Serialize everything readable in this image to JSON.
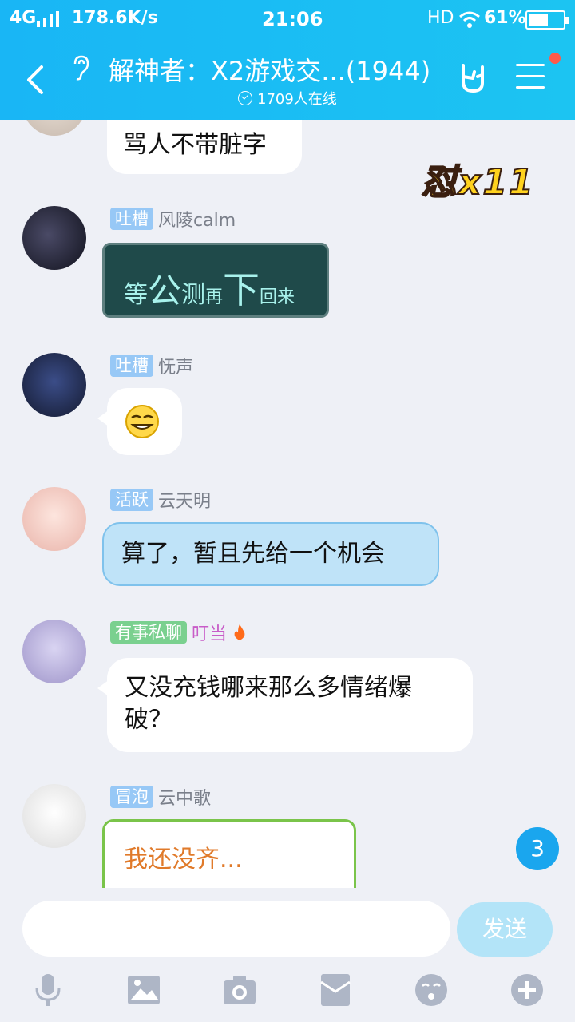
{
  "status_bar": {
    "network": "4G",
    "speed": "178.6K/s",
    "time": "21:06",
    "hd": "HD",
    "battery": "61%",
    "battery_level": 0.61
  },
  "header": {
    "title": "解神者：X2游戏交...(1944)",
    "online": "1709人在线",
    "icons": [
      "back-icon",
      "ear-icon",
      "rock-hand-icon",
      "menu-icon"
    ]
  },
  "messages": [
    {
      "text": "骂人不带脏字"
    },
    {
      "tag": "吐槽",
      "name": "风陵calm",
      "text_parts": [
        "等",
        "公",
        "测",
        "再",
        "下",
        "回来"
      ]
    },
    {
      "tag": "吐槽",
      "name": "怃声",
      "emoji": "grin-emoji"
    },
    {
      "tag": "活跃",
      "name": "云天明",
      "text": "算了，暂且先给一个机会"
    },
    {
      "tag": "有事私聊",
      "name": "叮当",
      "text": "又没充钱哪来那么多情绪爆破？"
    },
    {
      "tag": "冒泡",
      "name": "云中歌",
      "text": "我还没齐..."
    }
  ],
  "combo": "怼x11",
  "unread_badge": "3",
  "input": {
    "placeholder": "",
    "send_label": "发送"
  },
  "toolbar": [
    "mic-icon",
    "image-icon",
    "camera-icon",
    "red-packet-icon",
    "emoji-icon",
    "plus-icon"
  ],
  "colors": {
    "accent": "#19b6f5",
    "background": "#eef0f6",
    "send_disabled": "#b3e4f8"
  }
}
